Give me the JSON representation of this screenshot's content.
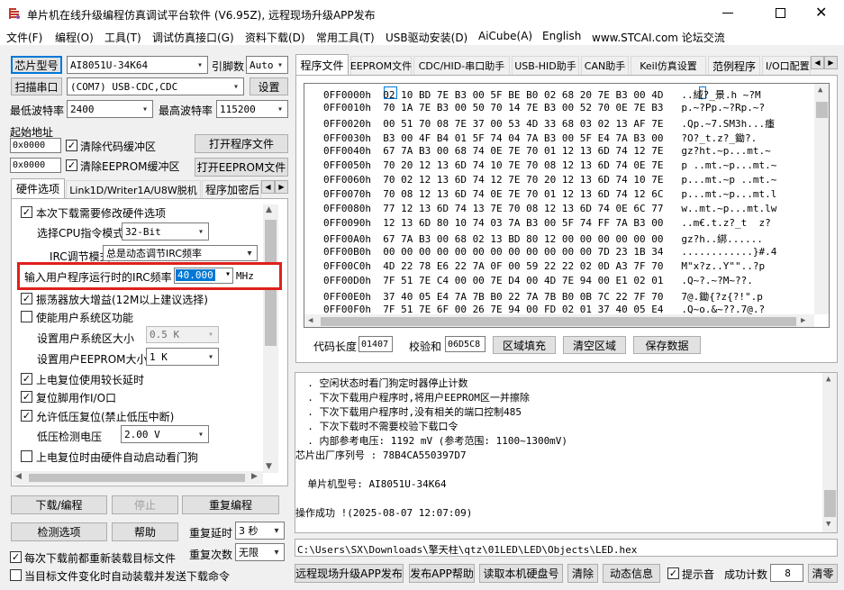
{
  "title": "单片机在线升级编程仿真调试平台软件 (V6.95Z), 远程现场升级APP发布",
  "menu": [
    "文件(F)",
    "编程(O)",
    "工具(T)",
    "调试仿真接口(G)",
    "资料下载(D)",
    "常用工具(T)",
    "USB驱动安装(D)",
    "AiCube(A)",
    "English",
    "www.STCAI.com 论坛交流"
  ],
  "left": {
    "chip_btn": "芯片型号",
    "chip_val": "AI8051U-34K64",
    "pins_label": "引脚数",
    "pins_val": "Auto",
    "scan_btn": "扫描串口",
    "port_val": "(COM7) USB-CDC,CDC",
    "settings_btn": "设置",
    "min_baud_label": "最低波特率",
    "min_baud": "2400",
    "max_baud_label": "最高波特率",
    "max_baud": "115200",
    "start_addr": "起始地址",
    "addr1": "0x0000",
    "clear_code": "清除代码缓冲区",
    "open_prog": "打开程序文件",
    "addr2": "0x0000",
    "clear_eeprom": "清除EEPROM缓冲区",
    "open_eeprom": "打开EEPROM文件",
    "tabs": [
      "硬件选项",
      "Link1D/Writer1A/U8W脱机",
      "程序加密后"
    ],
    "opt_modify": "本次下载需要修改硬件选项",
    "cpu_label": "选择CPU指令模式",
    "cpu_val": "32-Bit",
    "irc_label": "IRC调节模式",
    "irc_val": "总是动态调节IRC频率",
    "freq_label": "输入用户程序运行时的IRC频率",
    "freq_val": "40.000",
    "freq_unit": "MHz",
    "osc": "振荡器放大增益(12M以上建议选择)",
    "user_area": "使能用户系统区功能",
    "user_size_label": "设置用户系统区大小",
    "user_size": "0.5 K",
    "eeprom_size_label": "设置用户EEPROM大小",
    "eeprom_size": "1   K",
    "delay": "上电复位使用较长延时",
    "reset_io": "复位脚用作I/O口",
    "lvr": "允许低压复位(禁止低压中断)",
    "lvd_label": "低压检测电压",
    "lvd_val": "2.00 V",
    "wdt": "上电复位时由硬件自动启动看门狗",
    "download_btn": "下载/编程",
    "stop_btn": "停止",
    "reprog_btn": "重复编程",
    "check_btn": "检测选项",
    "help_btn": "帮助",
    "delay_label": "重复延时",
    "delay_val": "3 秒",
    "reload": "每次下载前都重新装载目标文件",
    "count_label": "重复次数",
    "count_val": "无限",
    "auto_reload": "当目标文件变化时自动装载并发送下载命令"
  },
  "right": {
    "tabs": [
      "程序文件",
      "EEPROM文件",
      "CDC/HID-串口助手",
      "USB-HID助手",
      "CAN助手",
      "Keil仿真设置",
      "范例程序",
      "I/O口配置"
    ],
    "hex_rows": [
      "0FF0000h  02 10 BD 7E B3 00 5F BE B0 02 68 20 7E B3 00 4D   ..緎?_景.h ~?M",
      "0FF0010h  70 1A 7E B3 00 50 70 14 7E B3 00 52 70 0E 7E B3   p.~?Pp.~?Rp.~?",
      "0FF0020h  00 51 70 08 7E 37 00 53 4D 33 68 03 02 13 AF 7E   .Qp.~7.SM3h...瘇",
      "0FF0030h  B3 00 4F B4 01 5F 74 04 7A B3 00 5F E4 7A B3 00   ?O?_t.z?_鋤?.",
      "0FF0040h  67 7A B3 00 68 74 0E 7E 70 01 12 13 6D 74 12 7E   gz?ht.~p...mt.~",
      "0FF0050h  70 20 12 13 6D 74 10 7E 70 08 12 13 6D 74 0E 7E   p ..mt.~p...mt.~",
      "0FF0060h  70 02 12 13 6D 74 12 7E 70 20 12 13 6D 74 10 7E   p...mt.~p ..mt.~",
      "0FF0070h  70 08 12 13 6D 74 0E 7E 70 01 12 13 6D 74 12 6C   p...mt.~p...mt.l",
      "0FF0080h  77 12 13 6D 74 13 7E 70 08 12 13 6D 74 0E 6C 77   w..mt.~p...mt.lw",
      "0FF0090h  12 13 6D 80 10 74 03 7A B3 00 5F 74 FF 7A B3 00   ..m€.t.z?_t  z?",
      "0FF00A0h  67 7A B3 00 68 02 13 BD 80 12 00 00 00 00 00 00   gz?h..綁......",
      "0FF00B0h  00 00 00 00 00 00 00 00 00 00 00 00 7D 23 1B 34   ............}#.4",
      "0FF00C0h  4D 22 78 E6 22 7A 0F 00 59 22 22 02 0D A3 7F 70   M\"x?z..Y\"\"..?p",
      "0FF00D0h  7F 51 7E C4 00 00 7E D4 00 4D 7E 94 00 E1 02 01   .Q~?.~?M~??.",
      "0FF00E0h  37 40 05 E4 7A 7B B0 22 7A 7B B0 0B 7C 22 7F 70   7@.鋤{?z{?!\".p",
      "0FF00F0h  7F 51 7E 6F 00 26 7E 94 00 FD 02 01 37 40 05 E4   .Q~o.&~??.7@.?"
    ],
    "code_len_label": "代码长度",
    "code_len": "01407",
    "checksum_label": "校验和",
    "checksum": "06D5C8",
    "fill_btn": "区域填充",
    "clear_btn": "清空区域",
    "save_btn": "保存数据",
    "log": [
      "  . 空闲状态时看门狗定时器停止计数",
      "  . 下次下载用户程序时,将用户EEPROM区一并擦除",
      "  . 下次下载用户程序时,没有相关的端口控制485",
      "  . 下次下载时不需要校验下载口令",
      "  . 内部参考电压: 1192 mV (参考范围: 1100~1300mV)",
      "芯片出厂序列号 : 78B4CA550397D7",
      "",
      "",
      "  单片机型号: AI8051U-34K64",
      "",
      "",
      "操作成功 !(2025-08-07 12:07:09)"
    ],
    "path": "C:\\Users\\SX\\Downloads\\擎天柱\\qtz\\01LED\\LED\\Objects\\LED.hex",
    "bottom": {
      "publish": "远程现场升级APP发布",
      "publish_help": "发布APP帮助",
      "read_disk": "读取本机硬盘号",
      "clear": "清除",
      "dynamic": "动态信息",
      "beep": "提示音",
      "success_label": "成功计数",
      "success_val": "8",
      "clear2": "清零"
    }
  }
}
